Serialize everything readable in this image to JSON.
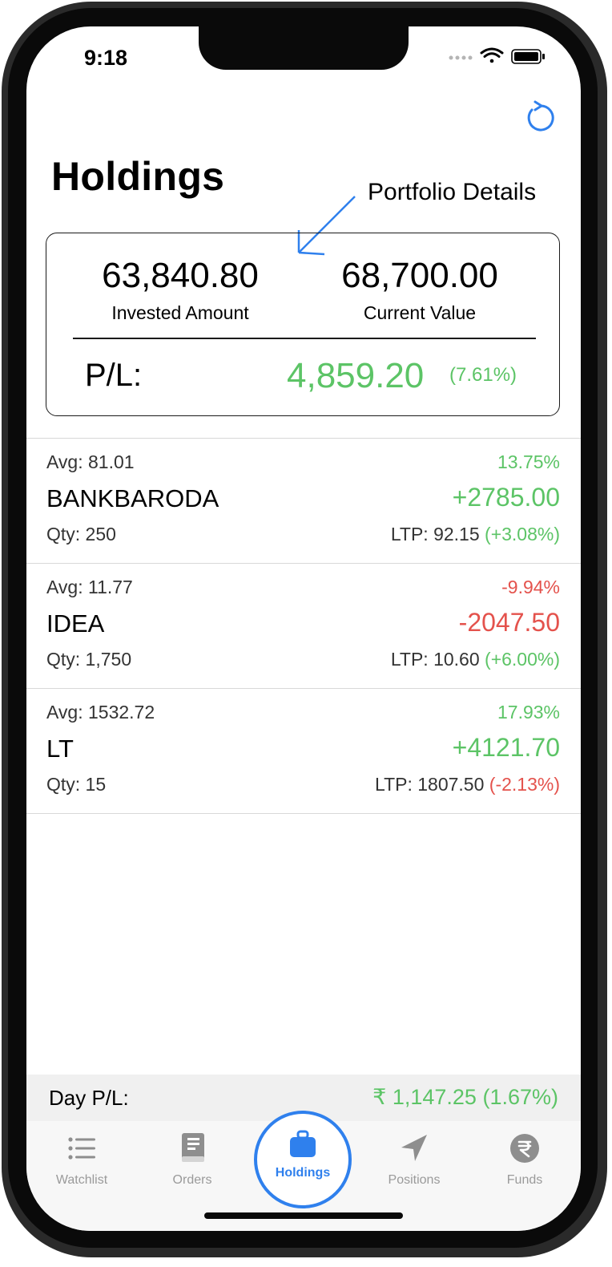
{
  "status_bar": {
    "time": "9:18"
  },
  "header": {
    "title": "Holdings",
    "annotation": "Portfolio Details"
  },
  "portfolio": {
    "invested_amount": "63,840.80",
    "invested_label": "Invested Amount",
    "current_value": "68,700.00",
    "current_label": "Current Value",
    "pl_label": "P/L:",
    "pl_value": "4,859.20",
    "pl_percent": "(7.61%)"
  },
  "holdings": [
    {
      "avg": "Avg: 81.01",
      "percent": "13.75%",
      "symbol": "BANKBARODA",
      "pnl": "+2785.00",
      "qty": "Qty: 250",
      "ltp": "LTP: 92.15",
      "ltp_change": "(+3.08%)"
    },
    {
      "avg": "Avg: 11.77",
      "percent": "-9.94%",
      "symbol": "IDEA",
      "pnl": "-2047.50",
      "qty": "Qty: 1,750",
      "ltp": "LTP: 10.60",
      "ltp_change": "(+6.00%)"
    },
    {
      "avg": "Avg: 1532.72",
      "percent": "17.93%",
      "symbol": "LT",
      "pnl": "+4121.70",
      "qty": "Qty: 15",
      "ltp": "LTP: 1807.50",
      "ltp_change": "(-2.13%)"
    }
  ],
  "day_pl": {
    "label": "Day P/L:",
    "value": "₹ 1,147.25 (1.67%)"
  },
  "tabs": [
    {
      "label": "Watchlist",
      "icon": "list-icon"
    },
    {
      "label": "Orders",
      "icon": "book-icon"
    },
    {
      "label": "Holdings",
      "icon": "briefcase-icon"
    },
    {
      "label": "Positions",
      "icon": "location-arrow-icon"
    },
    {
      "label": "Funds",
      "icon": "rupee-icon"
    }
  ],
  "colors": {
    "gain": "#5cc466",
    "loss": "#e4524c",
    "accent": "#2f80ed"
  }
}
